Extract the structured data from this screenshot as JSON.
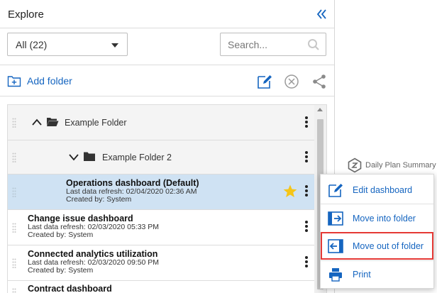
{
  "header": {
    "title": "Explore"
  },
  "filter": {
    "selected": "All (22)",
    "search_placeholder": "Search..."
  },
  "actions": {
    "add_folder_label": "Add folder"
  },
  "folders": [
    {
      "label": "Example Folder"
    },
    {
      "label": "Example Folder 2"
    }
  ],
  "dashboards": [
    {
      "title": "Operations dashboard (Default)",
      "refresh": "Last data refresh: 02/04/2020 02:36 AM",
      "created": "Created by: System",
      "starred": true
    },
    {
      "title": "Change issue dashboard",
      "refresh": "Last data refresh: 02/03/2020 05:33 PM",
      "created": "Created by: System"
    },
    {
      "title": "Connected analytics utilization",
      "refresh": "Last data refresh: 02/03/2020 09:50 PM",
      "created": "Created by: System"
    },
    {
      "title": "Contract dashboard"
    }
  ],
  "tile": {
    "label": "Daily Plan Summary"
  },
  "context_menu": {
    "items": [
      {
        "label": "Edit dashboard",
        "icon": "edit-icon"
      },
      {
        "label": "Move into folder",
        "icon": "move-into-folder-icon"
      },
      {
        "label": "Move out of folder",
        "icon": "move-out-of-folder-icon",
        "highlighted": true
      },
      {
        "label": "Print",
        "icon": "print-icon"
      }
    ]
  },
  "colors": {
    "accent": "#1565c0",
    "selected_row": "#cfe2f3",
    "highlight_border": "#e53935",
    "star": "#f5c518"
  }
}
